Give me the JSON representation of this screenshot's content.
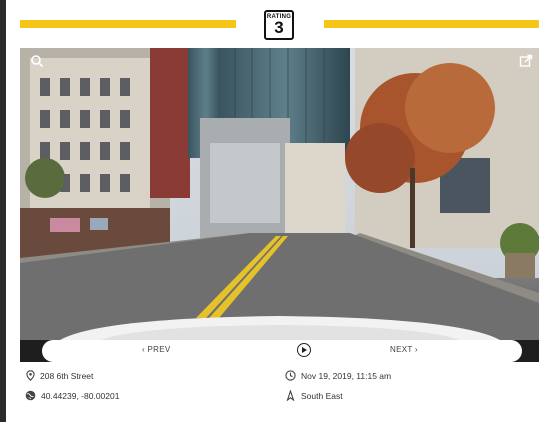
{
  "rating": {
    "label": "RATING",
    "value": "3"
  },
  "nav": {
    "prev_label": "‹ PREV",
    "next_label": "NEXT ›"
  },
  "location": {
    "address": "208 6th Street",
    "coordinates": "40.44239, -80.00201",
    "date": "Nov 19, 2019, 11:15 am",
    "direction": "South East"
  },
  "icons": {
    "search": "search-icon",
    "open_external": "open-external-icon",
    "play": "play-icon",
    "pin": "map-pin-icon",
    "globe": "globe-icon",
    "clock": "clock-icon",
    "compass": "compass-icon"
  },
  "colors": {
    "accent": "#f5c518",
    "dark": "#1e1e1e"
  }
}
